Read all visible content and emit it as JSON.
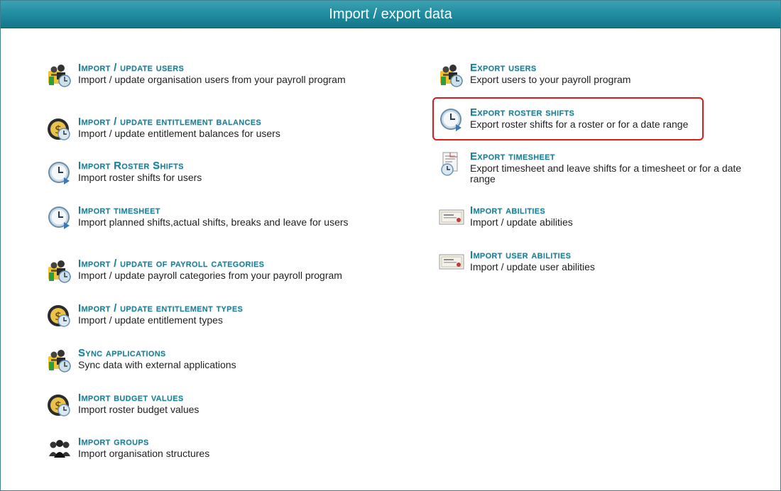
{
  "header": {
    "title": "Import / export data"
  },
  "left": [
    {
      "title": "Import / update users",
      "desc": "Import / update organisation users from your payroll program",
      "icon": "users-payroll-icon"
    },
    {
      "title": "Import / update entitlement balances",
      "desc": "Import / update entitlement balances for users",
      "icon": "entitlement-clock-icon"
    },
    {
      "title": "Import Roster Shifts",
      "desc": "Import roster shifts for users",
      "icon": "roster-clock-icon"
    },
    {
      "title": "Import timesheet",
      "desc": "Import planned shifts,actual shifts, breaks and leave for users",
      "icon": "timesheet-clock-icon"
    },
    {
      "title": "Import / update of payroll categories",
      "desc": "Import / update payroll categories from your payroll program",
      "icon": "users-payroll-icon"
    },
    {
      "title": "Import / update entitlement types",
      "desc": "Import / update entitlement types",
      "icon": "entitlement-clock-icon"
    },
    {
      "title": "Sync applications",
      "desc": "Sync data with external applications",
      "icon": "users-payroll-icon"
    },
    {
      "title": "Import budget values",
      "desc": "Import roster budget values",
      "icon": "entitlement-clock-icon"
    },
    {
      "title": "Import groups",
      "desc": "Import organisation structures",
      "icon": "groups-icon"
    }
  ],
  "right": [
    {
      "title": "Export users",
      "desc": "Export users to your payroll program",
      "icon": "users-payroll-icon"
    },
    {
      "title": "Export roster shifts",
      "desc": "Export roster shifts for a roster or for a date range",
      "icon": "roster-clock-icon",
      "highlighted": true
    },
    {
      "title": "Export timesheet",
      "desc": "Export timesheet and leave shifts for a timesheet or for a date range",
      "icon": "timesheet-document-icon"
    },
    {
      "title": "Import abilities",
      "desc": "Import / update abilities",
      "icon": "certificate-icon"
    },
    {
      "title": "Import user abilities",
      "desc": "Import / update user abilities",
      "icon": "certificate-icon"
    }
  ],
  "colors": {
    "header": "#1f8a9e",
    "link": "#1e7f95",
    "highlight": "#e01a1a"
  }
}
